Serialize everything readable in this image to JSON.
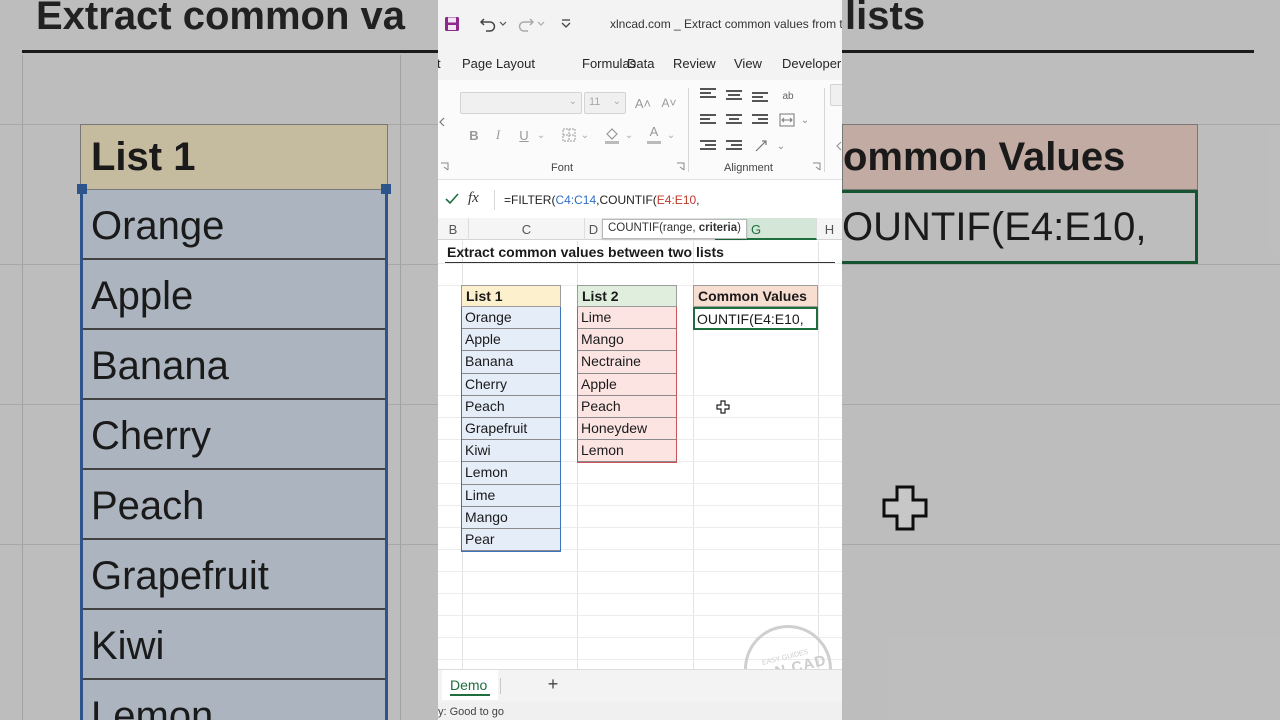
{
  "background": {
    "title": "Extract common va",
    "title_right": "lists",
    "list_header": "List 1",
    "list_items": [
      "Orange",
      "Apple",
      "Banana",
      "Cherry",
      "Peach",
      "Grapefruit",
      "Kiwi",
      "Lemon"
    ],
    "cv_header": "ommon Values",
    "cv_formula": "OUNTIF(E4:E10,"
  },
  "window": {
    "title": "xlncad.com _ Extract common values from th"
  },
  "ribbon_tabs": [
    "t",
    "Page Layout",
    "Formulas",
    "Data",
    "Review",
    "View",
    "Developer"
  ],
  "ribbon": {
    "font_size": "11",
    "font_group_label": "Font",
    "alignment_group_label": "Alignment",
    "bold": "B",
    "italic": "I",
    "underline": "U",
    "grow_font": "A˄",
    "shrink_font": "A˅",
    "font_color": "A",
    "wrap_label": "ab"
  },
  "formula_bar": {
    "prefix": "=FILTER(",
    "ref1": "C4:C14",
    "mid": ",COUNTIF(",
    "ref2": "E4:E10",
    "suffix": ",",
    "fx": "fx"
  },
  "tooltip": {
    "func": "COUNTIF(range, ",
    "arg": "criteria",
    "close": ")"
  },
  "columns": [
    "B",
    "C",
    "D",
    "G",
    "H"
  ],
  "sheet": {
    "title": "Extract common values between two lists",
    "list1_header": "List 1",
    "list1": [
      "Orange",
      "Apple",
      "Banana",
      "Cherry",
      "Peach",
      "Grapefruit",
      "Kiwi",
      "Lemon",
      "Lime",
      "Mango",
      "Pear"
    ],
    "list2_header": "List 2",
    "list2": [
      "Lime",
      "Mango",
      "Nectraine",
      "Apple",
      "Peach",
      "Honeydew",
      "Lemon"
    ],
    "cv_header": "Common Values",
    "cv_value": "OUNTIF(E4:E10,"
  },
  "watermark": {
    "main": "XL N CAD",
    "sub": "EASY GUIDES"
  },
  "sheet_tabs": {
    "active": "Demo",
    "add": "+"
  },
  "status": "y: Good to go",
  "colors": {
    "excel_green": "#1e6e3e",
    "list1_fill": "#e4edf8",
    "list2_fill": "#fbe4e2",
    "list1_header": "#fdf0cc",
    "list2_header": "#dfeedd",
    "cv_header": "#f8ddd1",
    "ref_blue": "#2f6fc8",
    "ref_red": "#c0392b"
  }
}
